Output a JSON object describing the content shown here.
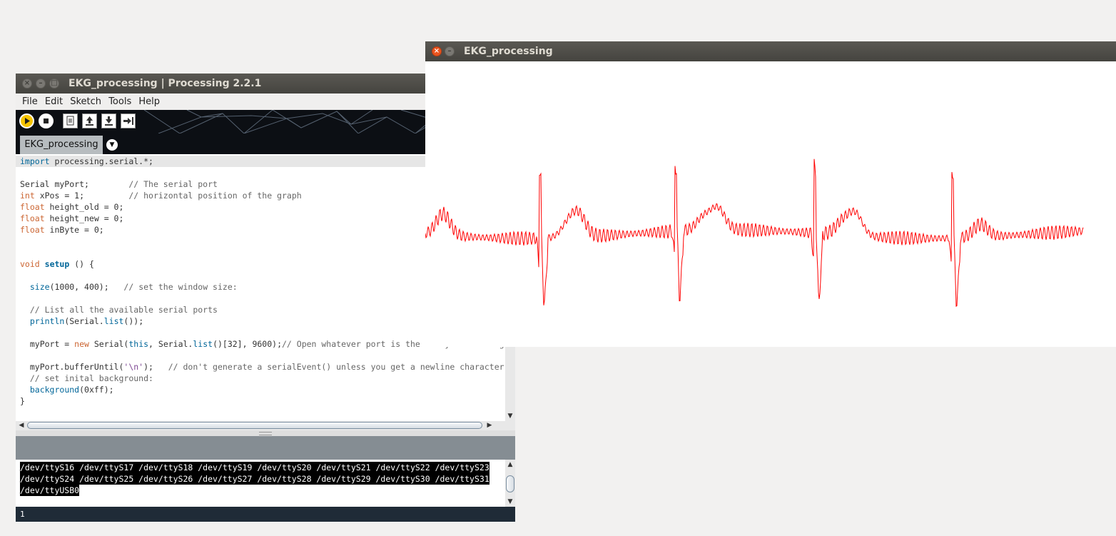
{
  "ide": {
    "title": "EKG_processing | Processing 2.2.1",
    "menu": [
      "File",
      "Edit",
      "Sketch",
      "Tools",
      "Help"
    ],
    "tab_label": "EKG_processing",
    "code_lines": [
      "import processing.serial.*;",
      "",
      "Serial myPort;        // The serial port",
      "int xPos = 1;         // horizontal position of the graph",
      "float height_old = 0;",
      "float height_new = 0;",
      "float inByte = 0;",
      "",
      "",
      "void setup () {",
      "",
      "  size(1000, 400);   // set the window size:",
      "",
      "  // List all the available serial ports",
      "  println(Serial.list());",
      "",
      "  myPort = new Serial(this, Serial.list()[32], 9600);// Open whatever port is the one you're using.",
      "",
      "  myPort.bufferUntil('\\n');   // don't generate a serialEvent() unless you get a newline character:",
      "  // set inital background:",
      "  background(0xff);",
      "}"
    ],
    "console_lines": [
      "/dev/ttyS16 /dev/ttyS17 /dev/ttyS18 /dev/ttyS19 /dev/ttyS20 /dev/ttyS21 /dev/ttyS22 /dev/ttyS23",
      "/dev/ttyS24 /dev/ttyS25 /dev/ttyS26 /dev/ttyS27 /dev/ttyS28 /dev/ttyS29 /dev/ttyS30 /dev/ttyS31",
      "/dev/ttyUSB0"
    ],
    "line_number": "1"
  },
  "sketch": {
    "title": "EKG_processing",
    "trace_color": "#ff0000"
  },
  "colors": {
    "run_button": "#f5c400",
    "titlebar": "#45443f",
    "footer": "#1f2b37"
  }
}
